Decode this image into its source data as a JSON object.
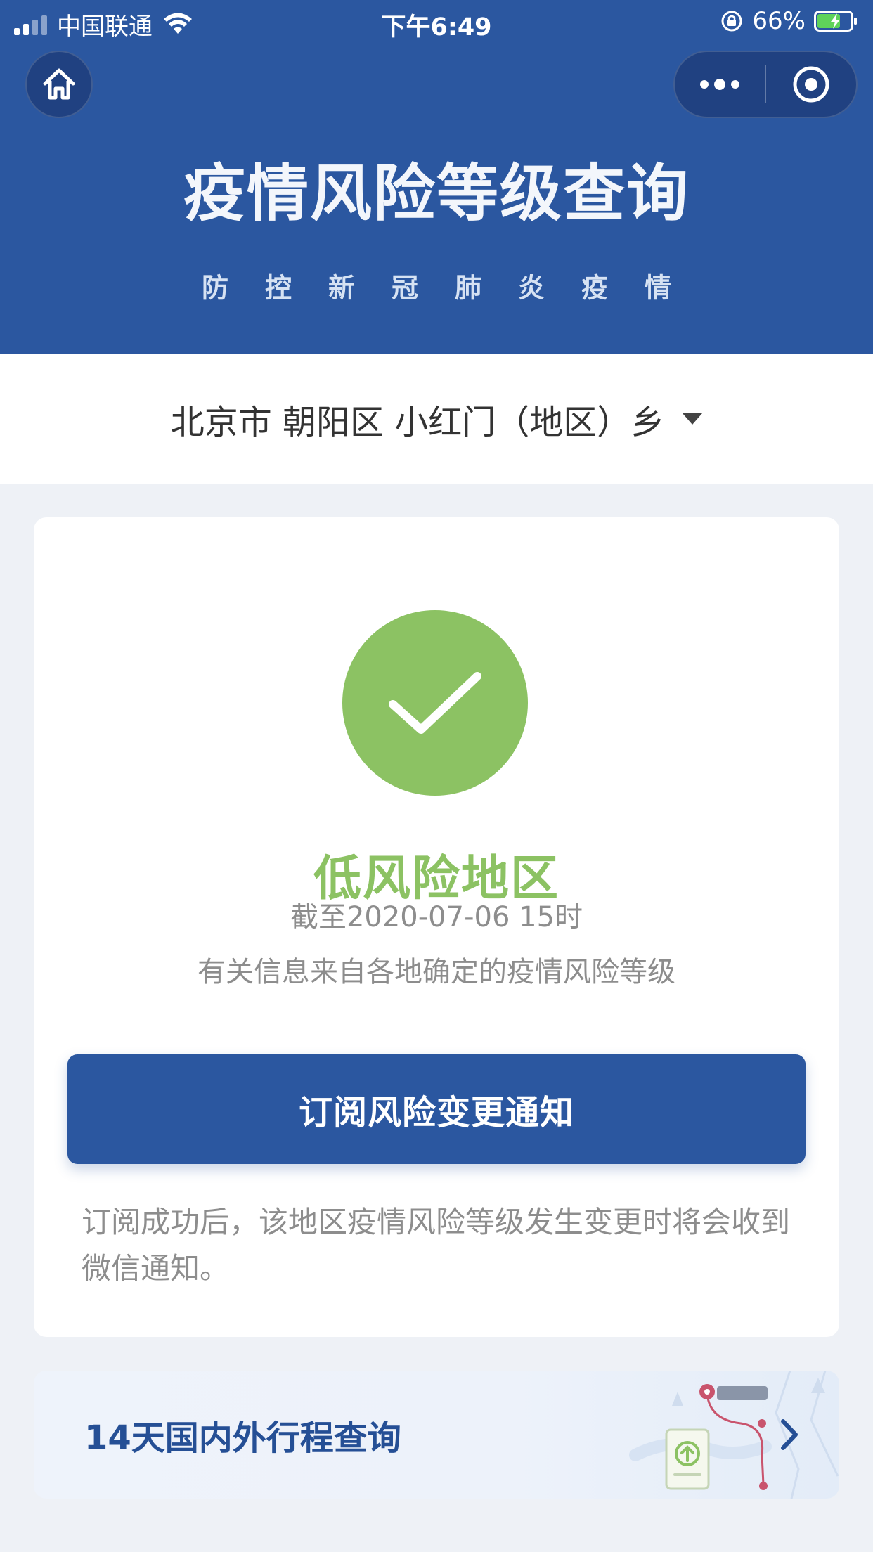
{
  "status_bar": {
    "carrier": "中国联通",
    "time": "下午6:49",
    "battery": "66%"
  },
  "header": {
    "title": "疫情风险等级查询",
    "subtitle": "防控新冠肺炎疫情"
  },
  "location": {
    "text": "北京市 朝阳区 小红门（地区）乡"
  },
  "result": {
    "level": "低风险地区",
    "as_of": "截至2020-07-06 15时",
    "source": "有关信息来自各地确定的疫情风险等级",
    "status_color": "#8cc263"
  },
  "subscribe": {
    "button_label": "订阅风险变更通知",
    "note": "订阅成功后，该地区疫情风险等级发生变更时将会收到微信通知。"
  },
  "trip": {
    "label": "14天国内外行程查询"
  },
  "colors": {
    "brand_blue": "#2b57a0",
    "low_risk_green": "#8cc263"
  },
  "icons": {
    "home": "home-icon",
    "more": "more-dots-icon",
    "close": "target-close-icon",
    "check": "check-icon",
    "dropdown": "caret-down-icon",
    "chevron": "chevron-right-icon"
  }
}
